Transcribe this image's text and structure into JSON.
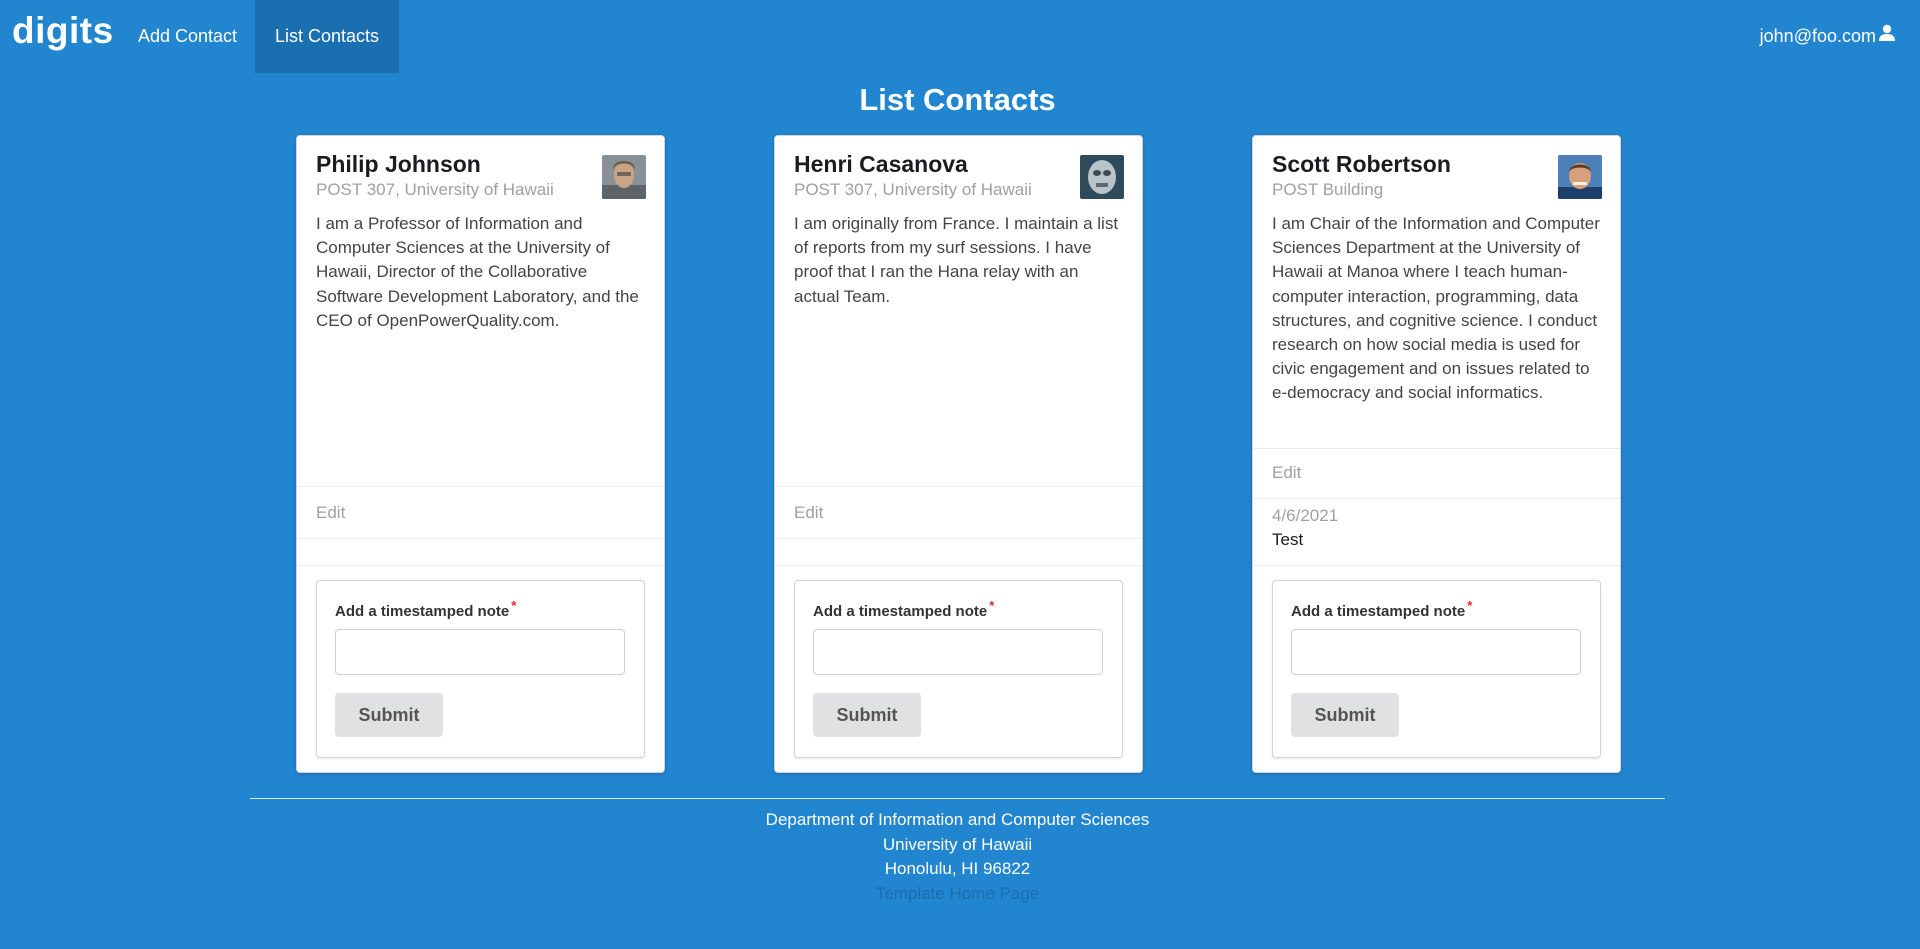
{
  "nav": {
    "brand": "digits",
    "items": [
      {
        "label": "Add Contact"
      },
      {
        "label": "List Contacts"
      }
    ],
    "user": "john@foo.com",
    "active_color": "#1a6fb0"
  },
  "page": {
    "title": "List Contacts",
    "background": "#2185d0"
  },
  "contacts": [
    {
      "name": "Philip Johnson",
      "address": "POST 307, University of Hawaii",
      "description": "I am a Professor of Information and Computer Sciences at the University of Hawaii, Director of the Collaborative Software Development Laboratory, and the CEO of OpenPowerQuality.com.",
      "edit_label": "Edit",
      "notes": [],
      "form": {
        "label": "Add a timestamped note",
        "required_mark": "*",
        "input_value": "",
        "submit_label": "Submit"
      }
    },
    {
      "name": "Henri Casanova",
      "address": "POST 307, University of Hawaii",
      "description": "I am originally from France. I maintain a list of reports from my surf sessions. I have proof that I ran the Hana relay with an actual Team.",
      "edit_label": "Edit",
      "notes": [],
      "form": {
        "label": "Add a timestamped note",
        "required_mark": "*",
        "input_value": "",
        "submit_label": "Submit"
      }
    },
    {
      "name": "Scott Robertson",
      "address": "POST Building",
      "description": "I am Chair of the Information and Computer Sciences Department at the University of Hawaii at Manoa where I teach human-computer interaction, programming, data structures, and cognitive science. I conduct research on how social media is used for civic engagement and on issues related to e-democracy and social informatics.",
      "edit_label": "Edit",
      "notes": [
        {
          "date": "4/6/2021",
          "text": "Test"
        }
      ],
      "form": {
        "label": "Add a timestamped note",
        "required_mark": "*",
        "input_value": "",
        "submit_label": "Submit"
      }
    }
  ],
  "footer": {
    "line1": "Department of Information and Computer Sciences",
    "line2": "University of Hawaii",
    "line3": "Honolulu, HI 96822",
    "link": "Template Home Page"
  }
}
